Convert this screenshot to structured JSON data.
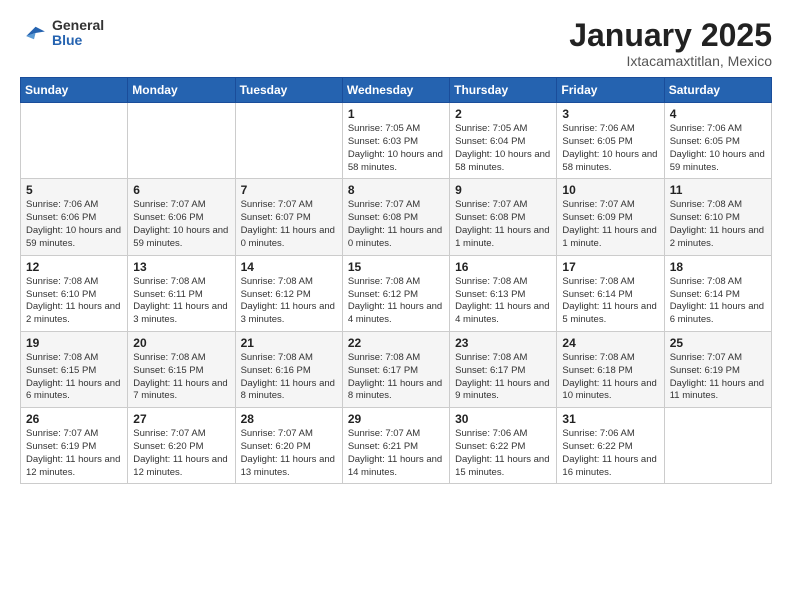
{
  "header": {
    "logo_general": "General",
    "logo_blue": "Blue",
    "month": "January 2025",
    "location": "Ixtacamaxtitlan, Mexico"
  },
  "weekdays": [
    "Sunday",
    "Monday",
    "Tuesday",
    "Wednesday",
    "Thursday",
    "Friday",
    "Saturday"
  ],
  "weeks": [
    [
      {
        "day": "",
        "info": ""
      },
      {
        "day": "",
        "info": ""
      },
      {
        "day": "",
        "info": ""
      },
      {
        "day": "1",
        "info": "Sunrise: 7:05 AM\nSunset: 6:03 PM\nDaylight: 10 hours\nand 58 minutes."
      },
      {
        "day": "2",
        "info": "Sunrise: 7:05 AM\nSunset: 6:04 PM\nDaylight: 10 hours\nand 58 minutes."
      },
      {
        "day": "3",
        "info": "Sunrise: 7:06 AM\nSunset: 6:05 PM\nDaylight: 10 hours\nand 58 minutes."
      },
      {
        "day": "4",
        "info": "Sunrise: 7:06 AM\nSunset: 6:05 PM\nDaylight: 10 hours\nand 59 minutes."
      }
    ],
    [
      {
        "day": "5",
        "info": "Sunrise: 7:06 AM\nSunset: 6:06 PM\nDaylight: 10 hours\nand 59 minutes."
      },
      {
        "day": "6",
        "info": "Sunrise: 7:07 AM\nSunset: 6:06 PM\nDaylight: 10 hours\nand 59 minutes."
      },
      {
        "day": "7",
        "info": "Sunrise: 7:07 AM\nSunset: 6:07 PM\nDaylight: 11 hours\nand 0 minutes."
      },
      {
        "day": "8",
        "info": "Sunrise: 7:07 AM\nSunset: 6:08 PM\nDaylight: 11 hours\nand 0 minutes."
      },
      {
        "day": "9",
        "info": "Sunrise: 7:07 AM\nSunset: 6:08 PM\nDaylight: 11 hours\nand 1 minute."
      },
      {
        "day": "10",
        "info": "Sunrise: 7:07 AM\nSunset: 6:09 PM\nDaylight: 11 hours\nand 1 minute."
      },
      {
        "day": "11",
        "info": "Sunrise: 7:08 AM\nSunset: 6:10 PM\nDaylight: 11 hours\nand 2 minutes."
      }
    ],
    [
      {
        "day": "12",
        "info": "Sunrise: 7:08 AM\nSunset: 6:10 PM\nDaylight: 11 hours\nand 2 minutes."
      },
      {
        "day": "13",
        "info": "Sunrise: 7:08 AM\nSunset: 6:11 PM\nDaylight: 11 hours\nand 3 minutes."
      },
      {
        "day": "14",
        "info": "Sunrise: 7:08 AM\nSunset: 6:12 PM\nDaylight: 11 hours\nand 3 minutes."
      },
      {
        "day": "15",
        "info": "Sunrise: 7:08 AM\nSunset: 6:12 PM\nDaylight: 11 hours\nand 4 minutes."
      },
      {
        "day": "16",
        "info": "Sunrise: 7:08 AM\nSunset: 6:13 PM\nDaylight: 11 hours\nand 4 minutes."
      },
      {
        "day": "17",
        "info": "Sunrise: 7:08 AM\nSunset: 6:14 PM\nDaylight: 11 hours\nand 5 minutes."
      },
      {
        "day": "18",
        "info": "Sunrise: 7:08 AM\nSunset: 6:14 PM\nDaylight: 11 hours\nand 6 minutes."
      }
    ],
    [
      {
        "day": "19",
        "info": "Sunrise: 7:08 AM\nSunset: 6:15 PM\nDaylight: 11 hours\nand 6 minutes."
      },
      {
        "day": "20",
        "info": "Sunrise: 7:08 AM\nSunset: 6:15 PM\nDaylight: 11 hours\nand 7 minutes."
      },
      {
        "day": "21",
        "info": "Sunrise: 7:08 AM\nSunset: 6:16 PM\nDaylight: 11 hours\nand 8 minutes."
      },
      {
        "day": "22",
        "info": "Sunrise: 7:08 AM\nSunset: 6:17 PM\nDaylight: 11 hours\nand 8 minutes."
      },
      {
        "day": "23",
        "info": "Sunrise: 7:08 AM\nSunset: 6:17 PM\nDaylight: 11 hours\nand 9 minutes."
      },
      {
        "day": "24",
        "info": "Sunrise: 7:08 AM\nSunset: 6:18 PM\nDaylight: 11 hours\nand 10 minutes."
      },
      {
        "day": "25",
        "info": "Sunrise: 7:07 AM\nSunset: 6:19 PM\nDaylight: 11 hours\nand 11 minutes."
      }
    ],
    [
      {
        "day": "26",
        "info": "Sunrise: 7:07 AM\nSunset: 6:19 PM\nDaylight: 11 hours\nand 12 minutes."
      },
      {
        "day": "27",
        "info": "Sunrise: 7:07 AM\nSunset: 6:20 PM\nDaylight: 11 hours\nand 12 minutes."
      },
      {
        "day": "28",
        "info": "Sunrise: 7:07 AM\nSunset: 6:20 PM\nDaylight: 11 hours\nand 13 minutes."
      },
      {
        "day": "29",
        "info": "Sunrise: 7:07 AM\nSunset: 6:21 PM\nDaylight: 11 hours\nand 14 minutes."
      },
      {
        "day": "30",
        "info": "Sunrise: 7:06 AM\nSunset: 6:22 PM\nDaylight: 11 hours\nand 15 minutes."
      },
      {
        "day": "31",
        "info": "Sunrise: 7:06 AM\nSunset: 6:22 PM\nDaylight: 11 hours\nand 16 minutes."
      },
      {
        "day": "",
        "info": ""
      }
    ]
  ]
}
